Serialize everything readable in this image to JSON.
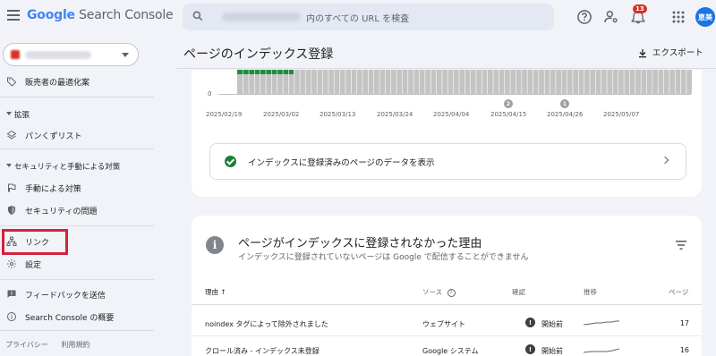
{
  "app": {
    "logo_google": "Google",
    "logo_product": "Search Console",
    "search_placeholder": "内のすべての URL を検査",
    "notification_count": "13",
    "avatar_text": "恵美"
  },
  "sidebar": {
    "items": [
      {
        "id": "merchant",
        "label": "販売者の最適化案",
        "icon": "tag-icon"
      },
      {
        "id": "breadcrumbs",
        "label": "パンくずリスト",
        "icon": "layers-icon"
      },
      {
        "id": "manual-actions",
        "label": "手動による対策",
        "icon": "flag-icon"
      },
      {
        "id": "security-issues",
        "label": "セキュリティの問題",
        "icon": "shield-icon"
      },
      {
        "id": "links",
        "label": "リンク",
        "icon": "sitemap-icon"
      },
      {
        "id": "settings",
        "label": "設定",
        "icon": "gear-icon"
      },
      {
        "id": "feedback",
        "label": "フィードバックを送信",
        "icon": "feedback-icon"
      },
      {
        "id": "about",
        "label": "Search Console の概要",
        "icon": "info-icon"
      }
    ],
    "sections": {
      "enhancements": "拡張",
      "security": "セキュリティと手動による対策"
    },
    "footer": {
      "privacy": "プライバシー",
      "terms": "利用規約"
    }
  },
  "main": {
    "title": "ページのインデックス登録",
    "export_label": "エクスポート",
    "chart": {
      "zero_label": "0",
      "dates": [
        "2025/02/19",
        "2025/03/02",
        "2025/03/13",
        "2025/03/24",
        "2025/04/04",
        "2025/04/15",
        "2025/04/26",
        "2025/05/07"
      ],
      "markers": [
        "2",
        "1"
      ]
    },
    "indexed_link": "インデックスに登録済みのページのデータを表示",
    "not_indexed": {
      "title": "ページがインデックスに登録されなかった理由",
      "subtitle": "インデックスに登録されていないページは Google で配信することができません",
      "columns": {
        "reason": "理由",
        "source": "ソース",
        "verification": "確認",
        "trend": "推移",
        "pages": "ページ"
      },
      "rows": [
        {
          "reason": "noindex タグによって除外されました",
          "source": "ウェブサイト",
          "status": "開始前",
          "pages": "17"
        },
        {
          "reason": "クロール済み - インデックス未登録",
          "source": "Google システム",
          "status": "開始前",
          "pages": "16"
        }
      ]
    }
  },
  "colors": {
    "accent": "#1a73e8",
    "highlight": "#d3233a",
    "success": "#188038",
    "bar_indexed": "#1e8e3e",
    "bar_not_indexed": "#c4c4c4"
  }
}
